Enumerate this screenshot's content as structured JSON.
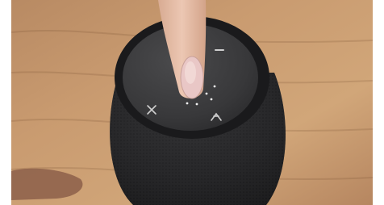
{
  "scene": {
    "subject": "portable-speaker",
    "colors": {
      "background_wood_light": "#c89c72",
      "background_wood_dark": "#8f6442",
      "speaker_fabric": "#2b2b2d",
      "speaker_top": "#3a3a3c",
      "skin": "#e7c3b0",
      "nail": "#e9c7c6",
      "led": "#f4f4f4"
    },
    "icons": [
      "bluetooth-icon",
      "mode-icon",
      "power-icon",
      "led-indicator-icon"
    ]
  }
}
